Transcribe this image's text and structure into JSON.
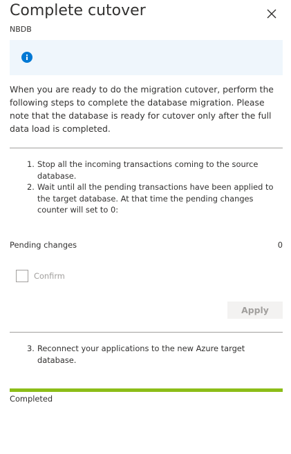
{
  "panel": {
    "title": "Complete cutover",
    "subtitle": "NBDB"
  },
  "info": {
    "description": "When you are ready to do the migration cutover, perform the following steps to complete the database migration. Please note that the database is ready for cutover only after the full data load is completed."
  },
  "steps_part1": [
    {
      "number": "1.",
      "text": "Stop all the incoming transactions coming to the source database."
    },
    {
      "number": "2.",
      "text": "Wait until all the pending transactions have been applied to the target database. At that time the pending changes counter will set to 0:"
    }
  ],
  "pending": {
    "label": "Pending changes",
    "value": "0"
  },
  "confirm": {
    "label": "Confirm",
    "checked": false
  },
  "apply_label": "Apply",
  "steps_part2": [
    {
      "number": "3.",
      "text": "Reconnect your applications to the new Azure target database."
    }
  ],
  "progress": {
    "fraction": 1.0,
    "status": "Completed"
  },
  "colors": {
    "info_background": "#eff6fc",
    "info_icon": "#0078d4",
    "progress": "#8cbd18",
    "disabled_text": "#a19f9d"
  },
  "icons": {
    "close": "close-icon",
    "info": "info-icon"
  }
}
